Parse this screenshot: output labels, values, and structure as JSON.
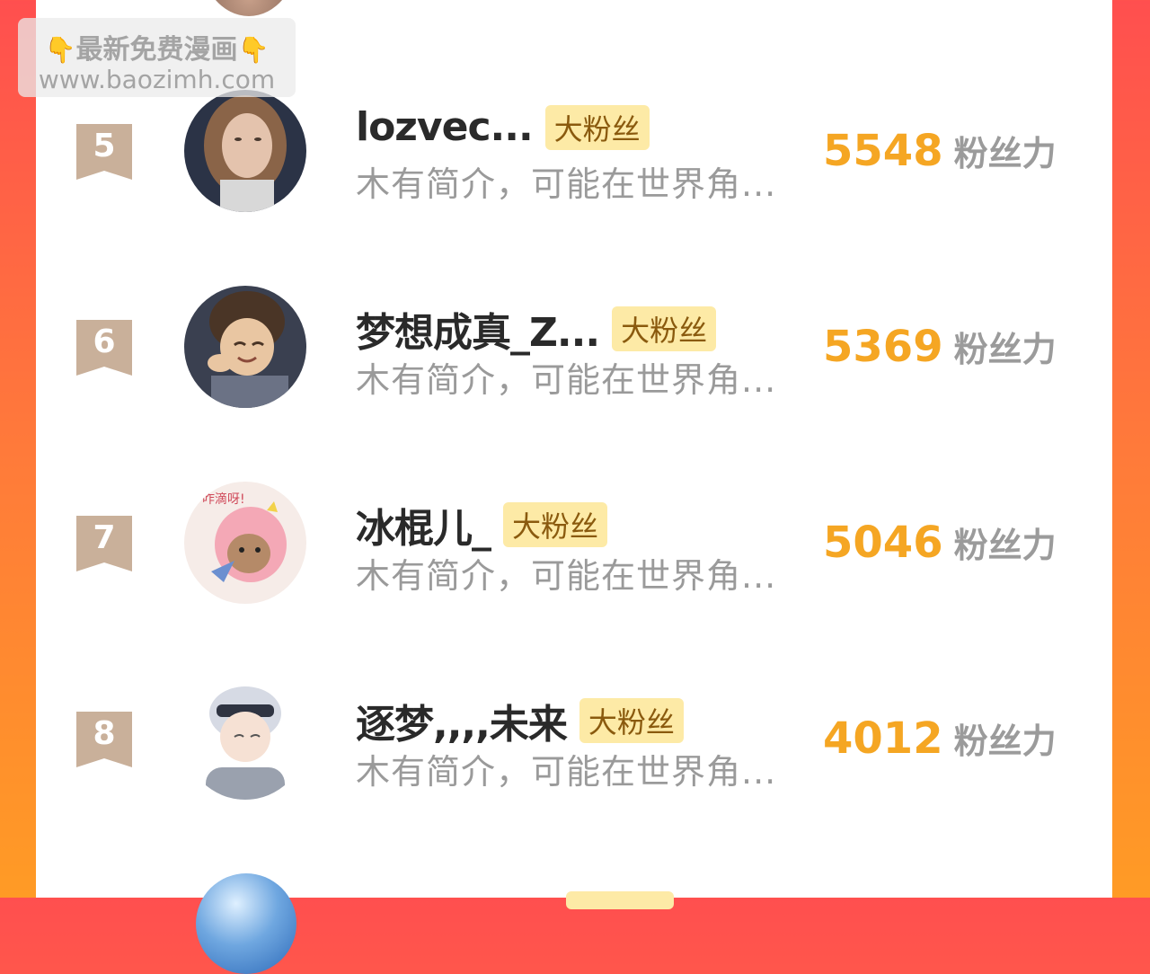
{
  "watermark": {
    "line1_left_icon": "pointing-down-hand-icon",
    "line1_text": "最新免费漫画",
    "line1_right_icon": "pointing-down-hand-icon",
    "line2_text": "www.baozimh.com"
  },
  "colors": {
    "background_gradient_top": "#ff4f4f",
    "background_gradient_bottom": "#ff9b25",
    "rank_badge": "#c9b09a",
    "score": "#f5a623",
    "fan_tag_bg": "#fdeaa6",
    "fan_tag_text": "#8a5a0e"
  },
  "rows": [
    {
      "rank": "5",
      "name": "lozvec...",
      "tag": "大粉丝",
      "bio": "木有简介，可能在世界角...",
      "score": "5548",
      "unit": "粉丝力",
      "avatar_icon": "woman-portrait-avatar"
    },
    {
      "rank": "6",
      "name": "梦想成真_Z...",
      "tag": "大粉丝",
      "bio": "木有简介，可能在世界角...",
      "score": "5369",
      "unit": "粉丝力",
      "avatar_icon": "anime-boy-avatar"
    },
    {
      "rank": "7",
      "name": "冰棍儿_",
      "tag": "大粉丝",
      "bio": "木有简介，可能在世界角...",
      "score": "5046",
      "unit": "粉丝力",
      "avatar_icon": "pink-dino-avatar"
    },
    {
      "rank": "8",
      "name": "逐梦,,,,未来",
      "tag": "大粉丝",
      "bio": "木有简介，可能在世界角...",
      "score": "4012",
      "unit": "粉丝力",
      "avatar_icon": "anime-silver-hair-avatar"
    }
  ]
}
